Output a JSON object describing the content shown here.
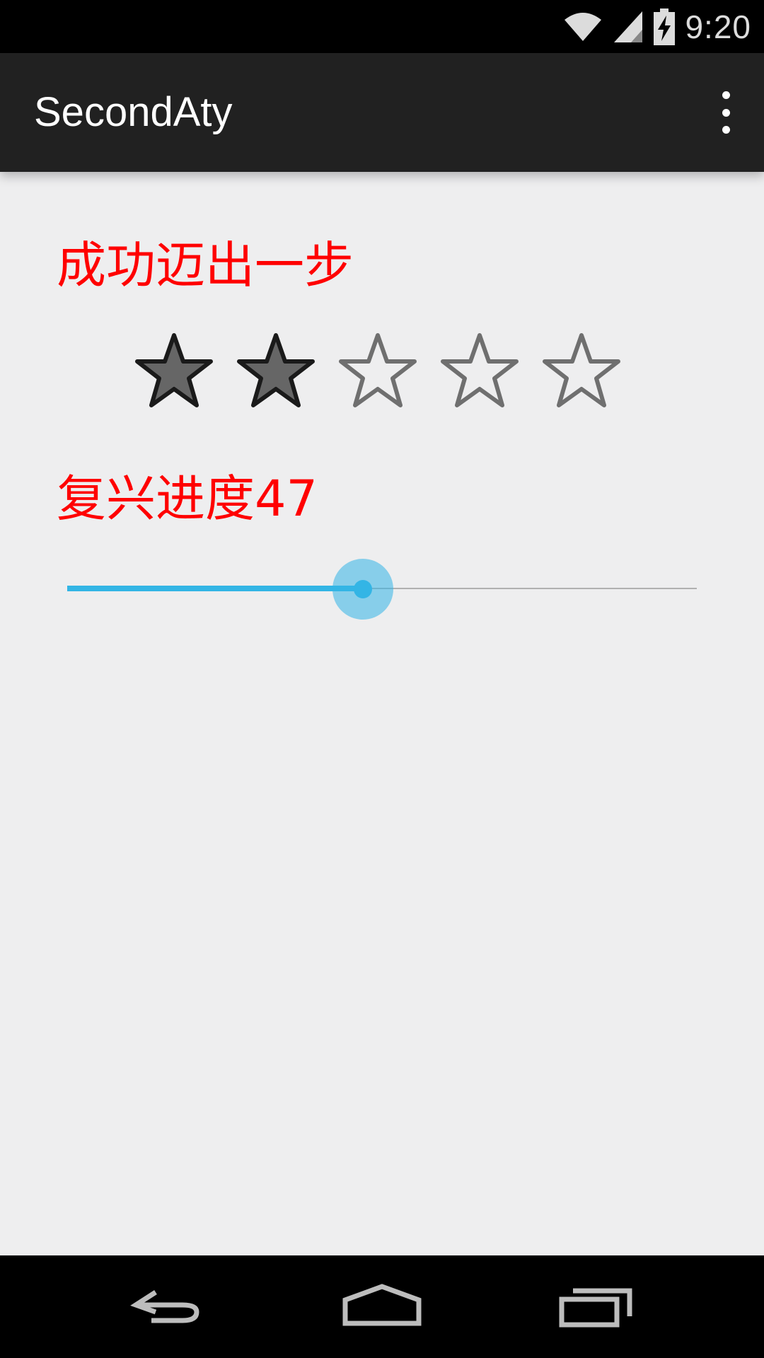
{
  "status_bar": {
    "time": "9:20",
    "icons": [
      "wifi-icon",
      "signal-icon",
      "battery-charging-icon"
    ]
  },
  "action_bar": {
    "title": "SecondAty",
    "overflow_icon": "overflow-menu-icon"
  },
  "main": {
    "rating_label": "成功迈出一步",
    "rating": {
      "value": 2,
      "max": 5
    },
    "progress_label": "复兴进度47",
    "seekbar": {
      "value": 47,
      "max": 100
    }
  },
  "colors": {
    "label": "#ff0000",
    "accent": "#33b5e5",
    "action_bar": "#212121",
    "background": "#eeeeef"
  },
  "nav_bar": {
    "icons": [
      "back-icon",
      "home-icon",
      "recent-apps-icon"
    ]
  }
}
